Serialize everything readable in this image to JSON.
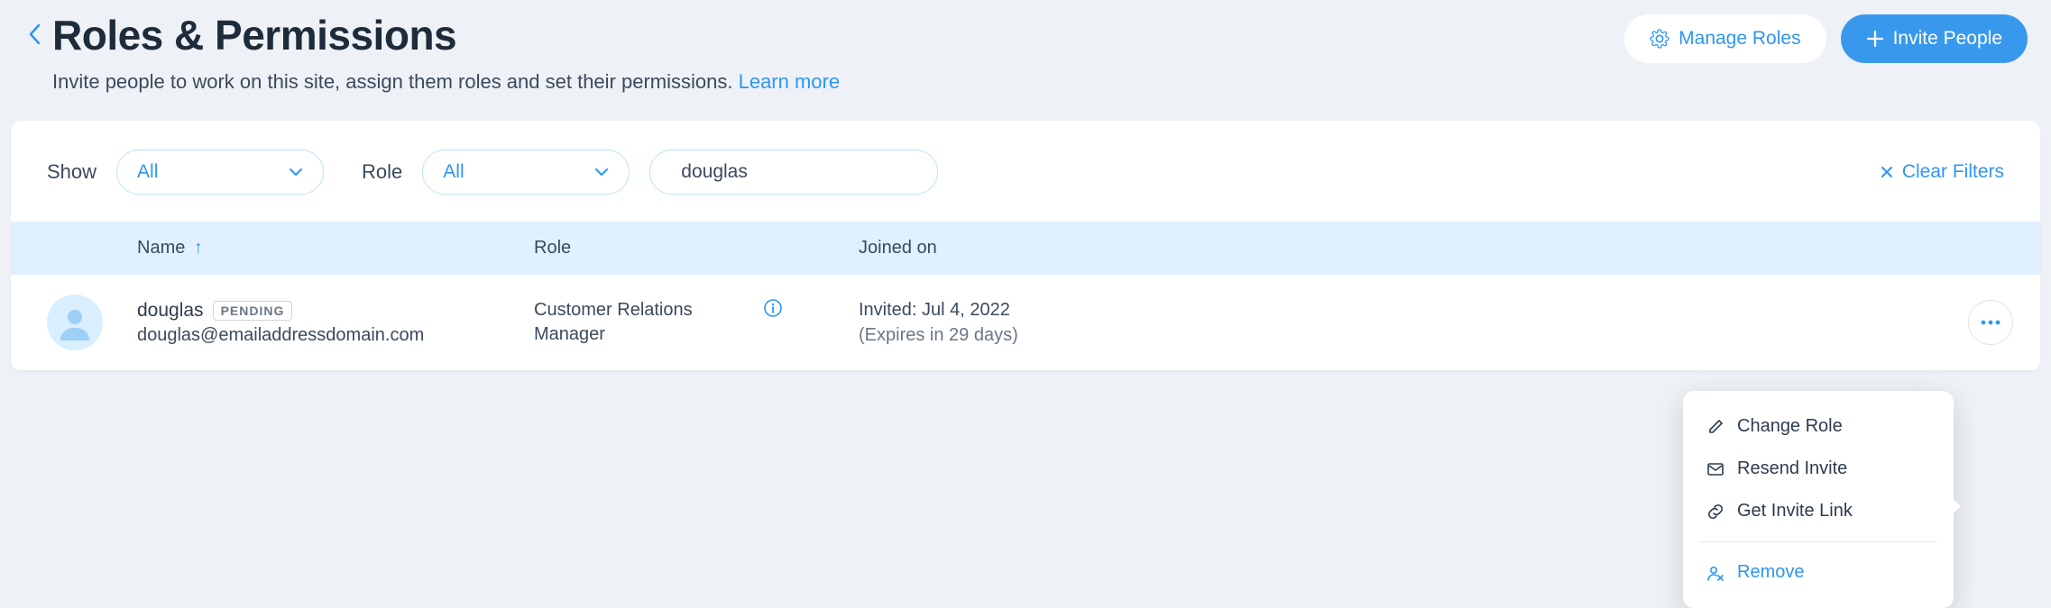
{
  "header": {
    "title": "Roles & Permissions",
    "subtitle_text": "Invite people to work on this site, assign them roles and set their permissions. ",
    "learn_more": "Learn more",
    "manage_roles": "Manage Roles",
    "invite_people": "Invite People"
  },
  "filters": {
    "show_label": "Show",
    "show_value": "All",
    "role_label": "Role",
    "role_value": "All",
    "search_value": "douglas",
    "clear": "Clear Filters"
  },
  "table": {
    "columns": {
      "name": "Name",
      "role": "Role",
      "joined": "Joined on"
    },
    "sort_indicator": "↑"
  },
  "row": {
    "name": "douglas",
    "badge": "PENDING",
    "email": "douglas@emailaddressdomain.com",
    "role": "Customer Relations Manager",
    "joined_line1": "Invited: Jul 4, 2022",
    "joined_line2": "(Expires in 29 days)"
  },
  "menu": {
    "change_role": "Change Role",
    "resend_invite": "Resend Invite",
    "get_link": "Get Invite Link",
    "remove": "Remove"
  }
}
